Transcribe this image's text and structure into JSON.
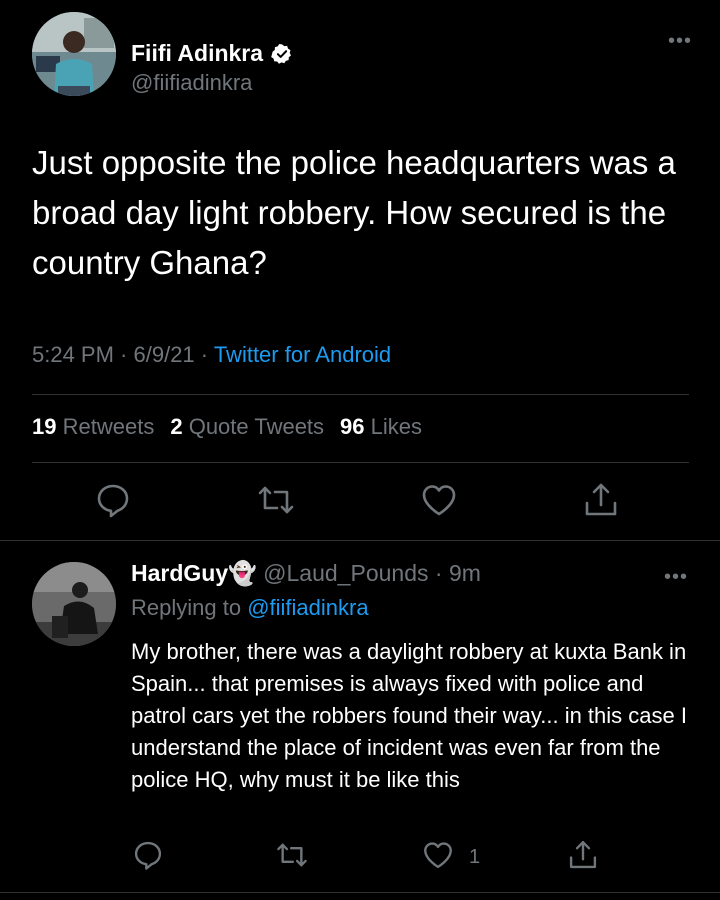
{
  "tweet": {
    "author_name": "Fiifi Adinkra",
    "author_handle": "@fiifiadinkra",
    "more": "•••",
    "text": "Just opposite the police headquarters was a broad day light robbery. How secured is the country Ghana?",
    "time": "5:24 PM",
    "date": "6/9/21",
    "separator": " · ",
    "source": "Twitter for Android",
    "stats": {
      "retweets_count": "19",
      "retweets_label": "Retweets",
      "quotes_count": "2",
      "quotes_label": "Quote Tweets",
      "likes_count": "96",
      "likes_label": "Likes"
    },
    "actions": [
      "reply-icon",
      "retweet-icon",
      "like-icon",
      "share-icon"
    ]
  },
  "reply": {
    "name": "HardGuy",
    "name_emoji": "👻",
    "handle": "@Laud_Pounds",
    "time": "9m",
    "separator": " · ",
    "more": "•••",
    "replying_label": "Replying to ",
    "replying_to": "@fiifiadinkra",
    "text": "My brother, there was a daylight robbery at kuxta Bank in Spain... that premises is always fixed with police and patrol cars yet the robbers found their way... in this case I understand the place of incident was even far from the police HQ, why must it be like this",
    "like_count": "1"
  },
  "colors": {
    "background": "#000000",
    "primary_text": "#ffffff",
    "secondary_text": "#71767b",
    "accent": "#1d9bf0",
    "divider": "#2f3336"
  }
}
